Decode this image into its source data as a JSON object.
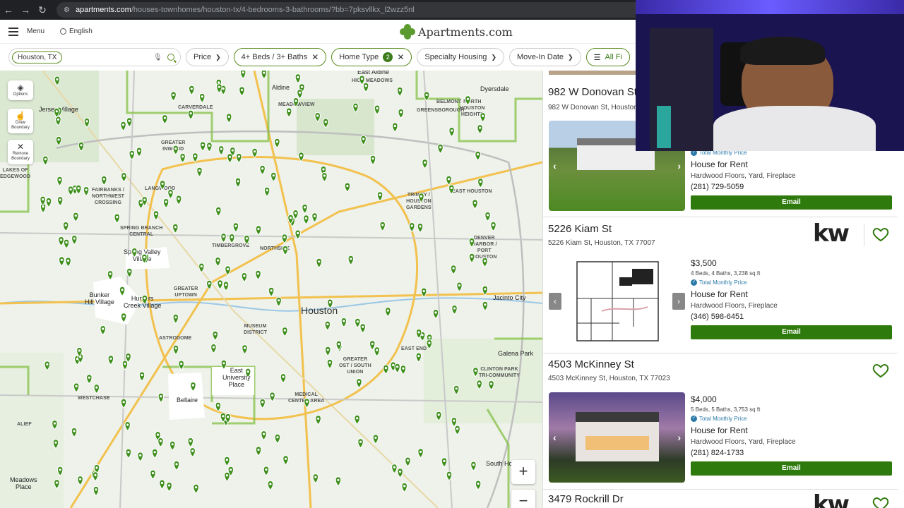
{
  "browser": {
    "url_domain": "apartments.com",
    "url_path": "/houses-townhomes/houston-tx/4-bedrooms-3-bathrooms/?bb=7pksvllkx_l2wzz5nl"
  },
  "header": {
    "menu_label": "Menu",
    "language_label": "English",
    "logo_text": "Apartments.com"
  },
  "filters": {
    "location_chip": "Houston, TX",
    "price": "Price",
    "beds_baths": "4+ Beds / 3+ Baths",
    "home_type": "Home Type",
    "home_type_count": "2",
    "specialty": "Specialty Housing",
    "move_in": "Move-In Date",
    "all_filters": "All Fi"
  },
  "map": {
    "controls": {
      "options": "Options",
      "draw": "Draw\nBoundary",
      "remove": "Remove\nBoundary"
    },
    "city_label": "Houston",
    "labels": [
      "East Aldine",
      "HIGH MEADOWS",
      "Aldine",
      "MEADOWVIEW",
      "Dyersdale",
      "BELMONT",
      "GREENSBOROUGH",
      "NORTH\nHOUSTON\nHEIGHTS",
      "Jersey Village",
      "CARVERDALE",
      "GREATER\nINWOOD",
      "FAIRBANKS /\nNORTHWEST\nCROSSING",
      "LANGWOOD",
      "EAST HOUSTON",
      "TRINITY /\nHOUSTON\nGARDENS",
      "SPRING BRANCH\nCENTRAL",
      "TIMBERGROVE",
      "NORTHSIDE",
      "DENVER\nHARBOR /\nPORT\nHOUSTON",
      "Spring Valley\nVillage",
      "Bunker\nHill Village",
      "Hunters\nCreek Village",
      "Jacinto City",
      "ASTRODOME",
      "GREATER\nUPTOWN",
      "MUSEUM\nDISTRICT",
      "EAST END",
      "CLINTON PARK\nTRI-COMMUNITY",
      "Galena Park",
      "East\nUniversity\nPlace",
      "Bellaire",
      "MEDICAL\nCENTER AREA",
      "GREATER\nOST / SOUTH\nUNION",
      "South Ho",
      "Meadows\nPlace",
      "ALIEF",
      "WESTCHASE",
      "LAKES OF\nEDGEWOOD"
    ],
    "zoom_in": "+",
    "zoom_out": "−"
  },
  "listings": [
    {
      "title": "982 W Donovan St",
      "address": "982 W Donovan St, Houston, TX 77091",
      "total_monthly": "Total Monthly Price",
      "type": "House for Rent",
      "amenities": "Hardwood Floors, Yard, Fireplace",
      "phone": "(281) 729-5059",
      "email": "Email"
    },
    {
      "title": "5226 Kiam St",
      "address": "5226 Kiam St, Houston, TX 77007",
      "price": "$3,500",
      "specs": "4 Beds, 4 Baths, 3,238 sq ft",
      "total_monthly": "Total Monthly Price",
      "type": "House for Rent",
      "amenities": "Hardwood Floors, Fireplace",
      "phone": "(346) 598-6451",
      "email": "Email",
      "logo": "kw"
    },
    {
      "title": "4503 McKinney St",
      "address": "4503 McKinney St, Houston, TX 77023",
      "price": "$4,000",
      "specs": "5 Beds, 5 Baths, 3,753 sq ft",
      "total_monthly": "Total Monthly Price",
      "type": "House for Rent",
      "amenities": "Hardwood Floors, Yard, Fireplace",
      "phone": "(281) 824-1733",
      "email": "Email"
    },
    {
      "title": "3479 Rockrill Dr",
      "logo": "kw"
    }
  ],
  "colors": {
    "brand_green": "#2f7a0d",
    "pin_green": "#3f8f1d",
    "map_bg": "#eef2ea",
    "accent_blue": "#2c7aa8"
  }
}
